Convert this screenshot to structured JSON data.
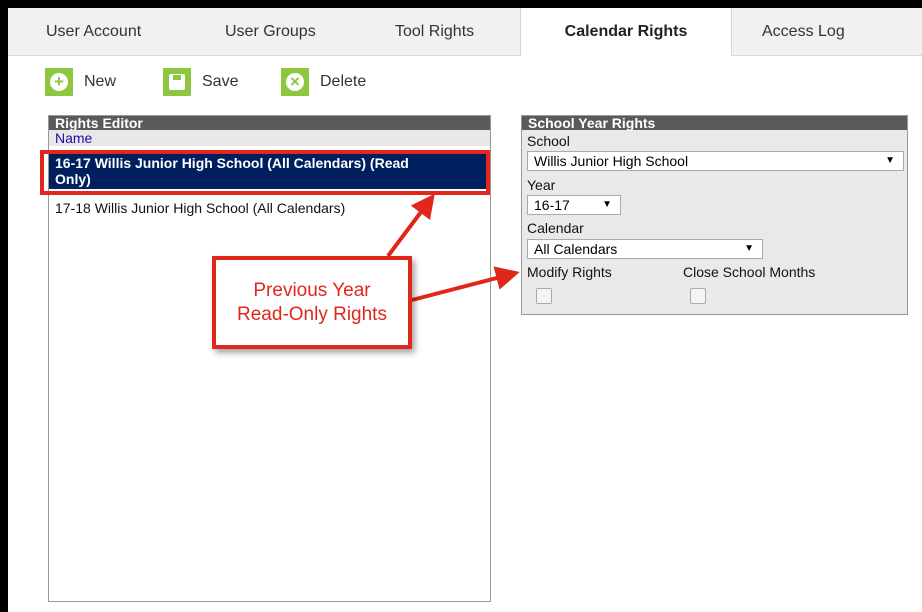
{
  "tabs": [
    {
      "label": "User Account"
    },
    {
      "label": "User Groups"
    },
    {
      "label": "Tool Rights"
    },
    {
      "label": "Calendar Rights"
    },
    {
      "label": "Access Log"
    }
  ],
  "active_tab": "Calendar Rights",
  "toolbar": {
    "new_label": "New",
    "save_label": "Save",
    "delete_label": "Delete"
  },
  "rights_editor": {
    "title": "Rights Editor",
    "column": "Name",
    "rows": [
      {
        "label_line1": "16-17 Willis Junior High School (All Calendars) (Read",
        "label_line2": "Only)",
        "selected": true
      },
      {
        "label": "17-18 Willis Junior High School (All Calendars)",
        "selected": false
      }
    ]
  },
  "school_year_rights": {
    "title": "School Year Rights",
    "school_label": "School",
    "school_value": "Willis Junior High School",
    "year_label": "Year",
    "year_value": "16-17",
    "calendar_label": "Calendar",
    "calendar_value": "All Calendars",
    "modify_rights_label": "Modify Rights",
    "close_months_label": "Close School Months",
    "dropdown_arrow": "▼"
  },
  "callout": {
    "line1": "Previous Year",
    "line2": "Read-Only Rights"
  },
  "colors": {
    "accent_green": "#8dc63f",
    "selected_row": "#001f5f",
    "callout_red": "#e1261c"
  }
}
